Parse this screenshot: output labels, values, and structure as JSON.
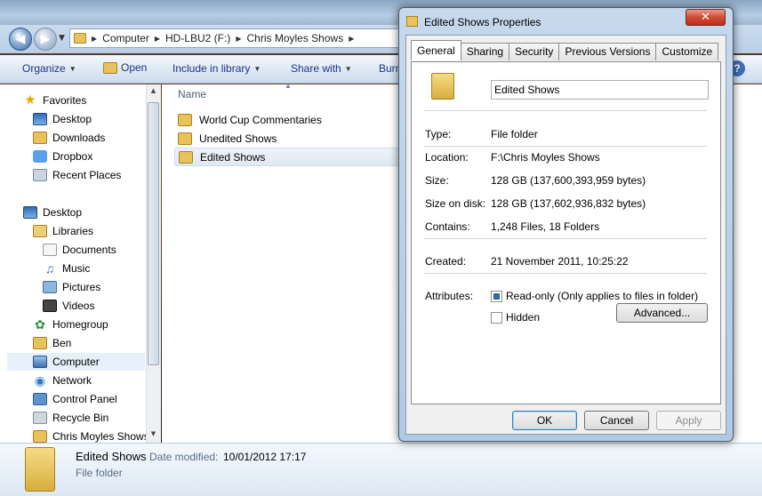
{
  "address": {
    "crumbs": [
      "Computer",
      "HD-LBU2 (F:)",
      "Chris Moyles Shows"
    ]
  },
  "toolbar": {
    "organize": "Organize",
    "open": "Open",
    "include": "Include in library",
    "share": "Share with",
    "burn": "Burn",
    "help": "?"
  },
  "nav": {
    "favorites": "Favorites",
    "desktop": "Desktop",
    "downloads": "Downloads",
    "dropbox": "Dropbox",
    "recent": "Recent Places",
    "desktop2": "Desktop",
    "libraries": "Libraries",
    "documents": "Documents",
    "music": "Music",
    "pictures": "Pictures",
    "videos": "Videos",
    "homegroup": "Homegroup",
    "ben": "Ben",
    "computer": "Computer",
    "network": "Network",
    "control_panel": "Control Panel",
    "recycle": "Recycle Bin",
    "chris": "Chris Moyles Shows"
  },
  "content": {
    "col_name": "Name",
    "files": [
      "World Cup Commentaries",
      "Unedited Shows",
      "Edited Shows"
    ]
  },
  "details": {
    "name": "Edited Shows",
    "modified_label": "Date modified:",
    "modified_value": "10/01/2012 17:17",
    "type": "File folder"
  },
  "dialog": {
    "title": "Edited Shows Properties",
    "close": "✕",
    "tabs": [
      "General",
      "Sharing",
      "Security",
      "Previous Versions",
      "Customize"
    ],
    "name_value": "Edited Shows",
    "labels": {
      "type": "Type:",
      "location": "Location:",
      "size": "Size:",
      "size_on_disk": "Size on disk:",
      "contains": "Contains:",
      "created": "Created:",
      "attributes": "Attributes:"
    },
    "values": {
      "type": "File folder",
      "location": "F:\\Chris Moyles Shows",
      "size": "128 GB (137,600,393,959 bytes)",
      "size_on_disk": "128 GB (137,602,936,832 bytes)",
      "contains": "1,248 Files, 18 Folders",
      "created": "21 November 2011, 10:25:22"
    },
    "readonly": "Read-only (Only applies to files in folder)",
    "hidden": "Hidden",
    "advanced": "Advanced...",
    "ok": "OK",
    "cancel": "Cancel",
    "apply": "Apply"
  }
}
